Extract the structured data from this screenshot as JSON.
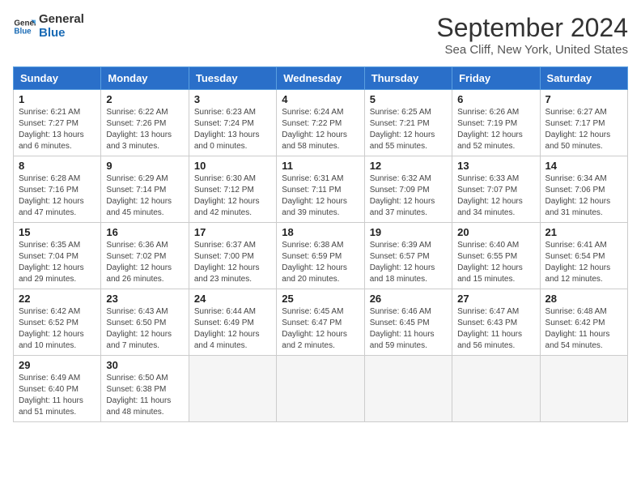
{
  "header": {
    "logo_line1": "General",
    "logo_line2": "Blue",
    "title": "September 2024",
    "subtitle": "Sea Cliff, New York, United States"
  },
  "days_of_week": [
    "Sunday",
    "Monday",
    "Tuesday",
    "Wednesday",
    "Thursday",
    "Friday",
    "Saturday"
  ],
  "weeks": [
    [
      {
        "day": "1",
        "info": "Sunrise: 6:21 AM\nSunset: 7:27 PM\nDaylight: 13 hours\nand 6 minutes."
      },
      {
        "day": "2",
        "info": "Sunrise: 6:22 AM\nSunset: 7:26 PM\nDaylight: 13 hours\nand 3 minutes."
      },
      {
        "day": "3",
        "info": "Sunrise: 6:23 AM\nSunset: 7:24 PM\nDaylight: 13 hours\nand 0 minutes."
      },
      {
        "day": "4",
        "info": "Sunrise: 6:24 AM\nSunset: 7:22 PM\nDaylight: 12 hours\nand 58 minutes."
      },
      {
        "day": "5",
        "info": "Sunrise: 6:25 AM\nSunset: 7:21 PM\nDaylight: 12 hours\nand 55 minutes."
      },
      {
        "day": "6",
        "info": "Sunrise: 6:26 AM\nSunset: 7:19 PM\nDaylight: 12 hours\nand 52 minutes."
      },
      {
        "day": "7",
        "info": "Sunrise: 6:27 AM\nSunset: 7:17 PM\nDaylight: 12 hours\nand 50 minutes."
      }
    ],
    [
      {
        "day": "8",
        "info": "Sunrise: 6:28 AM\nSunset: 7:16 PM\nDaylight: 12 hours\nand 47 minutes."
      },
      {
        "day": "9",
        "info": "Sunrise: 6:29 AM\nSunset: 7:14 PM\nDaylight: 12 hours\nand 45 minutes."
      },
      {
        "day": "10",
        "info": "Sunrise: 6:30 AM\nSunset: 7:12 PM\nDaylight: 12 hours\nand 42 minutes."
      },
      {
        "day": "11",
        "info": "Sunrise: 6:31 AM\nSunset: 7:11 PM\nDaylight: 12 hours\nand 39 minutes."
      },
      {
        "day": "12",
        "info": "Sunrise: 6:32 AM\nSunset: 7:09 PM\nDaylight: 12 hours\nand 37 minutes."
      },
      {
        "day": "13",
        "info": "Sunrise: 6:33 AM\nSunset: 7:07 PM\nDaylight: 12 hours\nand 34 minutes."
      },
      {
        "day": "14",
        "info": "Sunrise: 6:34 AM\nSunset: 7:06 PM\nDaylight: 12 hours\nand 31 minutes."
      }
    ],
    [
      {
        "day": "15",
        "info": "Sunrise: 6:35 AM\nSunset: 7:04 PM\nDaylight: 12 hours\nand 29 minutes."
      },
      {
        "day": "16",
        "info": "Sunrise: 6:36 AM\nSunset: 7:02 PM\nDaylight: 12 hours\nand 26 minutes."
      },
      {
        "day": "17",
        "info": "Sunrise: 6:37 AM\nSunset: 7:00 PM\nDaylight: 12 hours\nand 23 minutes."
      },
      {
        "day": "18",
        "info": "Sunrise: 6:38 AM\nSunset: 6:59 PM\nDaylight: 12 hours\nand 20 minutes."
      },
      {
        "day": "19",
        "info": "Sunrise: 6:39 AM\nSunset: 6:57 PM\nDaylight: 12 hours\nand 18 minutes."
      },
      {
        "day": "20",
        "info": "Sunrise: 6:40 AM\nSunset: 6:55 PM\nDaylight: 12 hours\nand 15 minutes."
      },
      {
        "day": "21",
        "info": "Sunrise: 6:41 AM\nSunset: 6:54 PM\nDaylight: 12 hours\nand 12 minutes."
      }
    ],
    [
      {
        "day": "22",
        "info": "Sunrise: 6:42 AM\nSunset: 6:52 PM\nDaylight: 12 hours\nand 10 minutes."
      },
      {
        "day": "23",
        "info": "Sunrise: 6:43 AM\nSunset: 6:50 PM\nDaylight: 12 hours\nand 7 minutes."
      },
      {
        "day": "24",
        "info": "Sunrise: 6:44 AM\nSunset: 6:49 PM\nDaylight: 12 hours\nand 4 minutes."
      },
      {
        "day": "25",
        "info": "Sunrise: 6:45 AM\nSunset: 6:47 PM\nDaylight: 12 hours\nand 2 minutes."
      },
      {
        "day": "26",
        "info": "Sunrise: 6:46 AM\nSunset: 6:45 PM\nDaylight: 11 hours\nand 59 minutes."
      },
      {
        "day": "27",
        "info": "Sunrise: 6:47 AM\nSunset: 6:43 PM\nDaylight: 11 hours\nand 56 minutes."
      },
      {
        "day": "28",
        "info": "Sunrise: 6:48 AM\nSunset: 6:42 PM\nDaylight: 11 hours\nand 54 minutes."
      }
    ],
    [
      {
        "day": "29",
        "info": "Sunrise: 6:49 AM\nSunset: 6:40 PM\nDaylight: 11 hours\nand 51 minutes."
      },
      {
        "day": "30",
        "info": "Sunrise: 6:50 AM\nSunset: 6:38 PM\nDaylight: 11 hours\nand 48 minutes."
      },
      {
        "day": "",
        "info": ""
      },
      {
        "day": "",
        "info": ""
      },
      {
        "day": "",
        "info": ""
      },
      {
        "day": "",
        "info": ""
      },
      {
        "day": "",
        "info": ""
      }
    ]
  ]
}
